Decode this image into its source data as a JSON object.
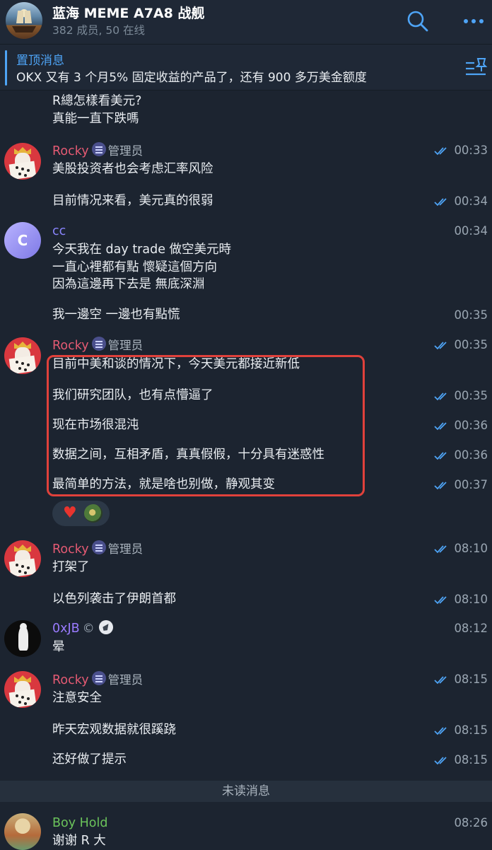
{
  "header": {
    "title": "蓝海 MEME A7A8 战舰",
    "subtitle": "382 成员, 50 在线"
  },
  "pinned": {
    "title": "置顶消息",
    "text": "OKX 又有 3 个月5% 固定收益的产品了，还有 900 多万美金额度"
  },
  "messages": {
    "m0": {
      "line1": "R總怎樣看美元?",
      "line2": "真能一直下跌嗎"
    },
    "m1": {
      "sender": "Rocky",
      "role": "管理员",
      "time": "00:33",
      "text": "美股投资者也会考虑汇率风险"
    },
    "m2": {
      "time": "00:34",
      "text": "目前情况来看，美元真的很弱"
    },
    "m3": {
      "sender": "cc",
      "avatar_letter": "C",
      "time": "00:34",
      "line1": "今天我在 day trade 做空美元時",
      "line2": "一直心裡都有點 懷疑這個方向",
      "line3": "因為這邊再下去是 無底深淵"
    },
    "m4": {
      "time": "00:35",
      "text": "我一邊空 一邊也有點慌"
    },
    "m5": {
      "sender": "Rocky",
      "role": "管理员",
      "time": "00:35",
      "text": "目前中美和谈的情况下，今天美元都接近新低"
    },
    "m6": {
      "time": "00:35",
      "text": "我们研究团队，也有点懵逼了"
    },
    "m7": {
      "time": "00:36",
      "text": "现在市场很混沌"
    },
    "m8": {
      "time": "00:36",
      "text": "数据之间，互相矛盾，真真假假，十分具有迷惑性"
    },
    "m9": {
      "time": "00:37",
      "text": "最简单的方法，就是啥也别做，静观其变"
    },
    "m10": {
      "sender": "Rocky",
      "role": "管理员",
      "time": "08:10",
      "text": "打架了"
    },
    "m11": {
      "time": "08:10",
      "text": "以色列袭击了伊朗首都"
    },
    "m12": {
      "sender": "0xJB",
      "copy_mark": "©",
      "time": "08:12",
      "text": "晕"
    },
    "m13": {
      "sender": "Rocky",
      "role": "管理员",
      "time": "08:15",
      "text": "注意安全"
    },
    "m14": {
      "time": "08:15",
      "text": "昨天宏观数据就很蹊跷"
    },
    "m15": {
      "time": "08:15",
      "text": "还好做了提示"
    },
    "m16": {
      "sender": "Boy Hold",
      "time": "08:26",
      "text": "谢谢 R 大"
    }
  },
  "reactions": {
    "heart": "♥"
  },
  "divider": {
    "unread": "未读消息"
  },
  "colors": {
    "background": "#1c2430",
    "accent": "#4ea4f6",
    "rocky": "#e45a73",
    "cc": "#8a85ff",
    "jb": "#9a7bff",
    "boy": "#6bc35b",
    "highlight": "#e0413b"
  },
  "icons": [
    "search-icon",
    "more-icon",
    "pinned-list-icon",
    "double-check-icon",
    "admin-badge-icon",
    "heart-icon",
    "bot-icon"
  ]
}
